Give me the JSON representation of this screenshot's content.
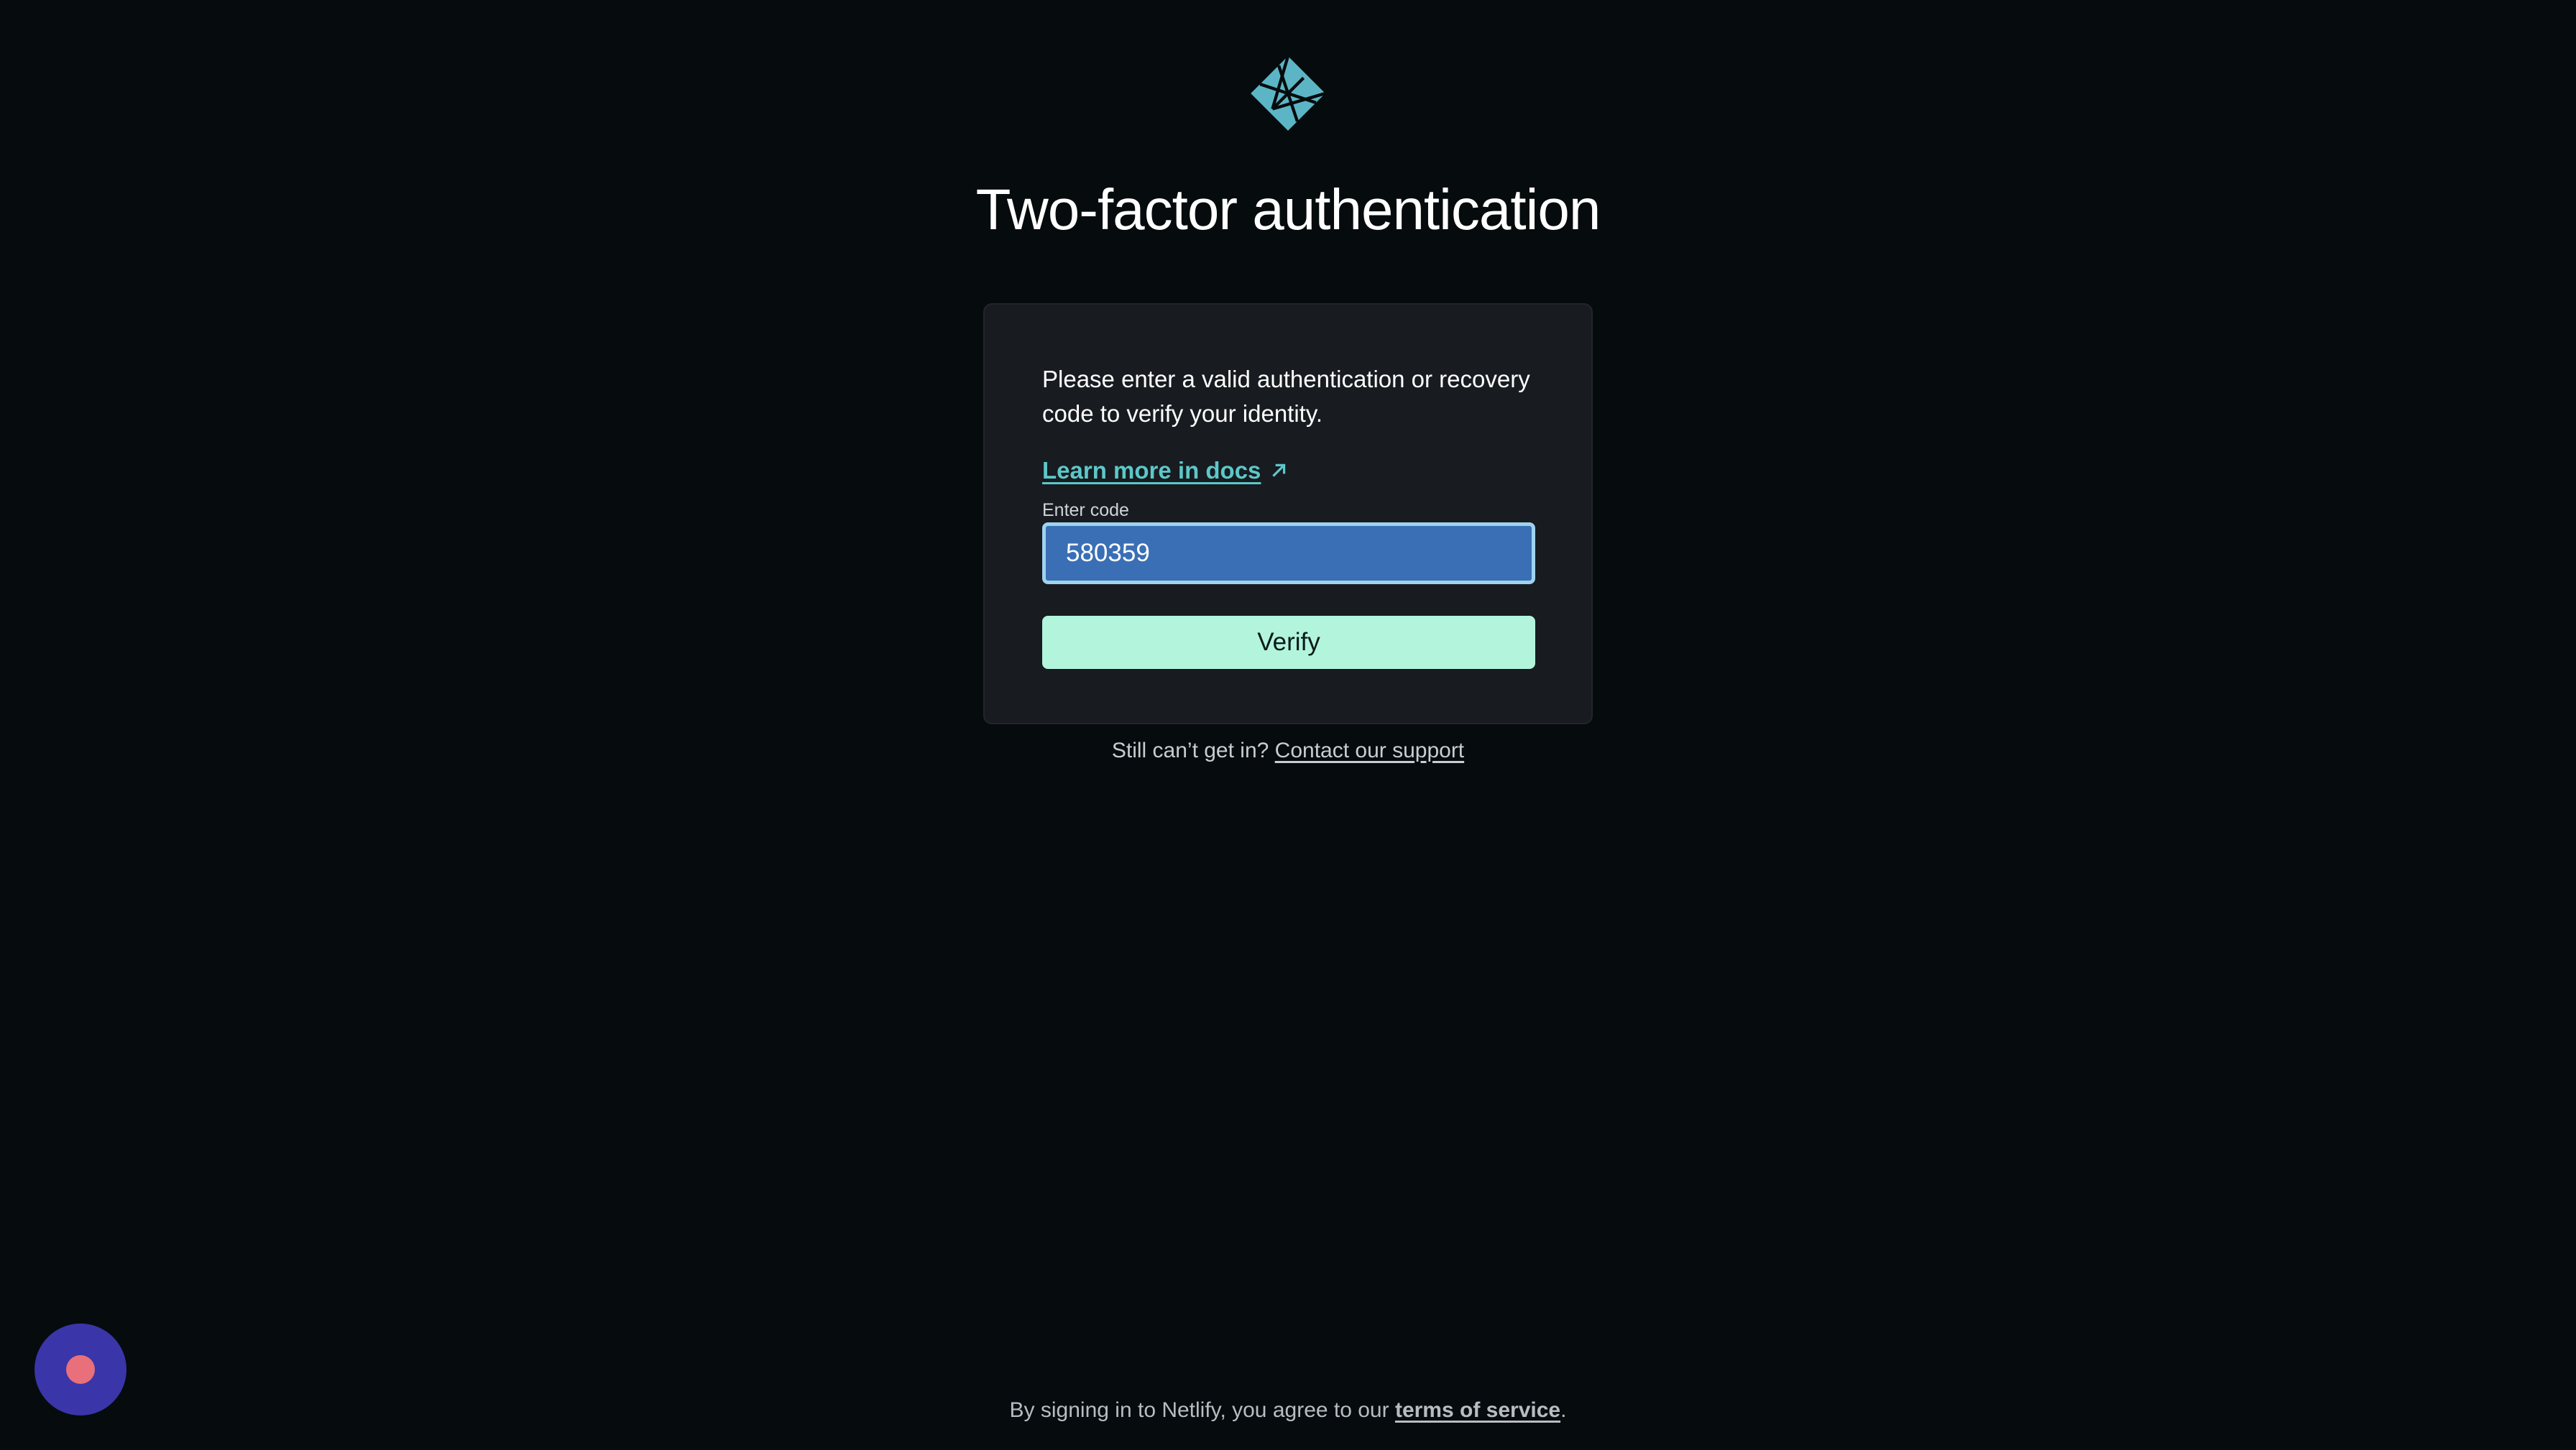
{
  "logo": {
    "icon": "netlify-logo-icon",
    "color": "#5cb5c5"
  },
  "title": "Two-factor authentication",
  "card": {
    "intro": "Please enter a valid authentication or recovery code to verify your identity.",
    "docs_link": "Learn more in docs",
    "code_label": "Enter code",
    "code_value": "580359",
    "verify_label": "Verify"
  },
  "support": {
    "prefix": "Still can’t get in?",
    "link": "Contact our support"
  },
  "footer": {
    "prefix": "By signing in to Netlify, you agree to our",
    "link": "terms of service",
    "suffix": "."
  },
  "fab": {
    "icon": "record-dot-icon"
  },
  "colors": {
    "background": "#060b0d",
    "card": "#181b20",
    "accent_link": "#5cc8c8",
    "button": "#b2f5dc",
    "input": "#3a6fb5",
    "fab": "#3a35a8"
  }
}
